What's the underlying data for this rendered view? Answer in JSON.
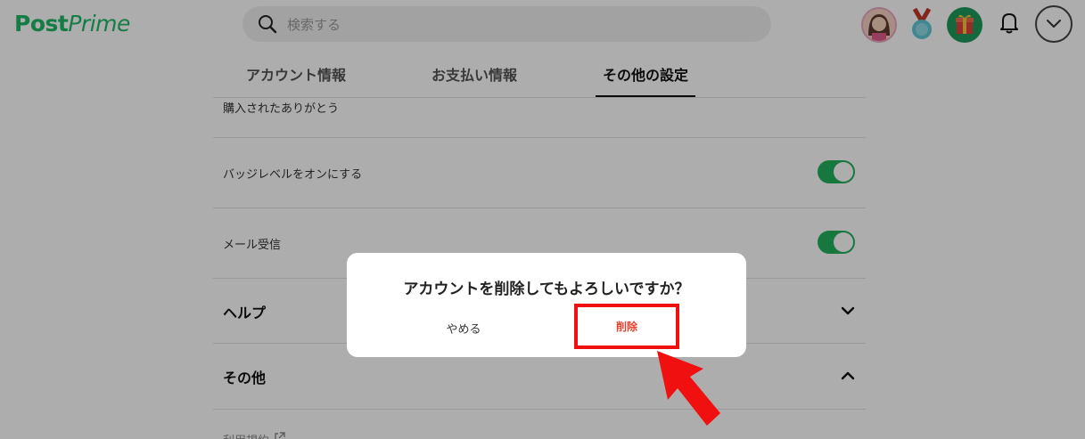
{
  "header": {
    "logo_bold": "Post",
    "logo_italic": "Prime",
    "search_placeholder": "検索する",
    "icons": [
      "search-icon",
      "avatar",
      "medal-icon",
      "gift-icon",
      "bell-icon",
      "chevron-down-icon"
    ]
  },
  "tabs": [
    {
      "label": "アカウント情報",
      "active": false
    },
    {
      "label": "お支払い情報",
      "active": false
    },
    {
      "label": "その他の設定",
      "active": true
    }
  ],
  "settings": {
    "thanks_label": "購入されたありがとう",
    "badge_label": "バッジレベルをオンにする",
    "badge_on": true,
    "mail_label": "メール受信",
    "mail_on": true,
    "help_label": "ヘルプ",
    "other_label": "その他",
    "terms_label": "利用規約"
  },
  "dialog": {
    "message": "アカウントを削除してもよろしいですか？",
    "cancel_label": "やめる",
    "delete_label": "削除"
  },
  "colors": {
    "brand": "#1db866",
    "toggle_on": "#23b15e",
    "delete_text": "#e5432f",
    "highlight": "#f01010"
  }
}
